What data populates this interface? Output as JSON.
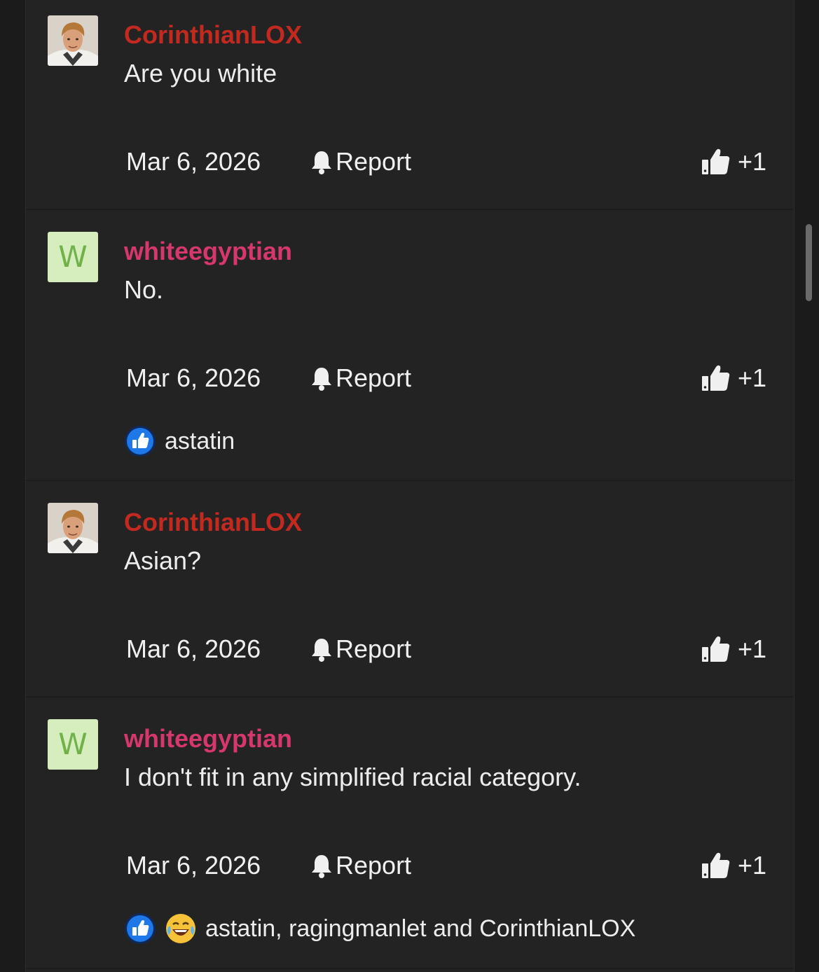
{
  "colors": {
    "background": "#1b1b1c",
    "panel": "#232324",
    "username_red": "#c2291f",
    "username_pink": "#d6376c",
    "letter_avatar_bg": "#d6edbd",
    "letter_avatar_fg": "#72b04a",
    "like_reaction_blue": "#1f78e8"
  },
  "comments": [
    {
      "avatar": {
        "type": "photo",
        "icon": "user-photo-avatar"
      },
      "username": "CorinthianLOX",
      "text": "Are you white",
      "date": "Mar 6, 2026",
      "report_label": "Report",
      "like_label": "+1",
      "reactions": null
    },
    {
      "avatar": {
        "type": "letter",
        "letter": "W"
      },
      "username": "whiteegyptian",
      "text": "No.",
      "date": "Mar 6, 2026",
      "report_label": "Report",
      "like_label": "+1",
      "reactions": {
        "icons": [
          "thumbs-up-reaction-icon"
        ],
        "text": "astatin"
      }
    },
    {
      "avatar": {
        "type": "photo",
        "icon": "user-photo-avatar"
      },
      "username": "CorinthianLOX",
      "text": "Asian?",
      "date": "Mar 6, 2026",
      "report_label": "Report",
      "like_label": "+1",
      "reactions": null
    },
    {
      "avatar": {
        "type": "letter",
        "letter": "W"
      },
      "username": "whiteegyptian",
      "text": "I don't fit in any simplified racial category.",
      "date": "Mar 6, 2026",
      "report_label": "Report",
      "like_label": "+1",
      "reactions": {
        "icons": [
          "thumbs-up-reaction-icon",
          "laughing-crying-reaction-icon"
        ],
        "text": "astatin, ragingmanlet and CorinthianLOX"
      }
    }
  ]
}
